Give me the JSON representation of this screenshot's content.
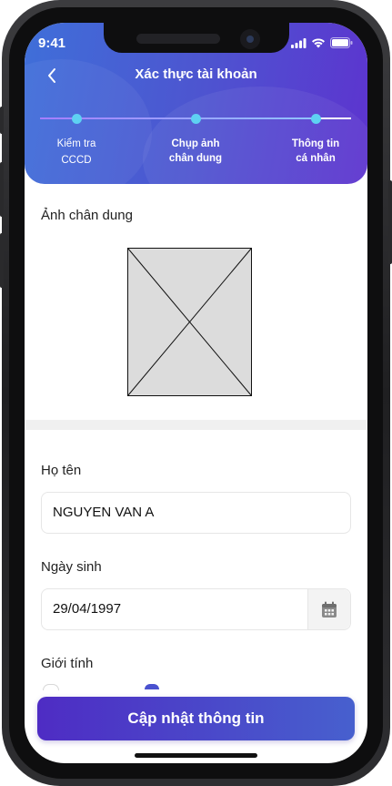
{
  "status_bar": {
    "time": "9:41"
  },
  "header": {
    "title": "Xác thực tài khoản",
    "steps": [
      {
        "label_line1": "Kiểm tra",
        "label_line2": "CCCD"
      },
      {
        "label_line1": "Chụp ảnh",
        "label_line2": "chân dung"
      },
      {
        "label_line1": "Thông tin",
        "label_line2": "cá nhân"
      }
    ]
  },
  "portrait": {
    "label": "Ảnh chân dung"
  },
  "form": {
    "name_label": "Họ tên",
    "name_value": "NGUYEN VAN A",
    "dob_label": "Ngày sinh",
    "dob_value": "29/04/1997",
    "gender_label": "Giới tính"
  },
  "actions": {
    "update_label": "Cập nhật thông tin"
  },
  "colors": {
    "accent": "#4e2cc4",
    "step_dot": "#5ed1f2"
  }
}
